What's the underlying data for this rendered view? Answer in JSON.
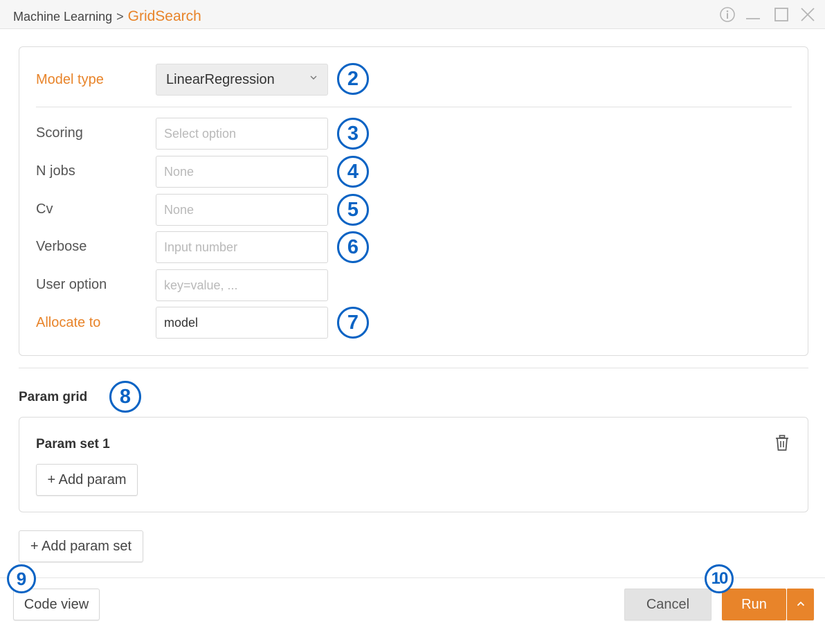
{
  "breadcrumb": {
    "parent": "Machine Learning",
    "separator": ">",
    "current": "GridSearch"
  },
  "window_controls": [
    "info-icon",
    "minimize-icon",
    "maximize-icon",
    "close-icon"
  ],
  "form": {
    "model_type": {
      "label": "Model type",
      "value": "LinearRegression"
    },
    "scoring": {
      "label": "Scoring",
      "placeholder": "Select option"
    },
    "n_jobs": {
      "label": "N jobs",
      "placeholder": "None"
    },
    "cv": {
      "label": "Cv",
      "placeholder": "None"
    },
    "verbose": {
      "label": "Verbose",
      "placeholder": "Input number"
    },
    "user_option": {
      "label": "User option",
      "placeholder": "key=value, ..."
    },
    "allocate_to": {
      "label": "Allocate to",
      "value": "model"
    }
  },
  "param_grid": {
    "title": "Param grid",
    "sets": [
      {
        "title": "Param set 1",
        "add_param_label": "+ Add param"
      }
    ],
    "add_param_set_label": "+ Add param set"
  },
  "footer": {
    "code_view_label": "Code view",
    "cancel_label": "Cancel",
    "run_label": "Run"
  },
  "callouts": {
    "model_type": "2",
    "scoring": "3",
    "n_jobs": "4",
    "cv": "5",
    "verbose": "6",
    "allocate_to": "7",
    "param_grid": "8",
    "code_view": "9",
    "run": "10"
  },
  "colors": {
    "accent": "#e8842a",
    "callout": "#0a63c4"
  }
}
